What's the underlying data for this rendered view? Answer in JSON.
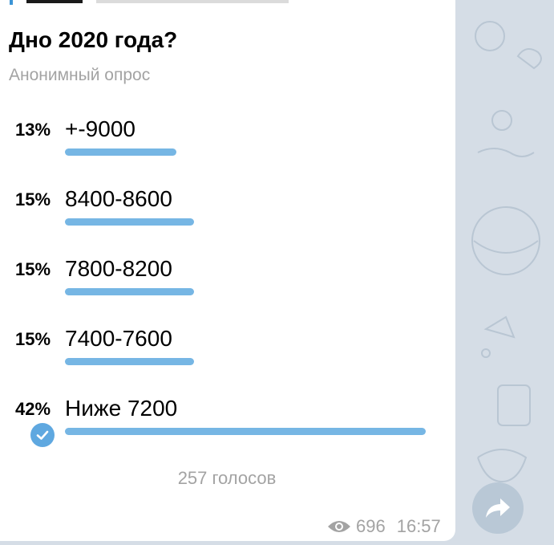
{
  "poll": {
    "title": "Дно 2020 года?",
    "type": "Анонимный опрос",
    "options": [
      {
        "percent": "13%",
        "label": "+-9000",
        "fraction": 0.13,
        "chosen": false
      },
      {
        "percent": "15%",
        "label": "8400-8600",
        "fraction": 0.15,
        "chosen": false
      },
      {
        "percent": "15%",
        "label": "7800-8200",
        "fraction": 0.15,
        "chosen": false
      },
      {
        "percent": "15%",
        "label": "7400-7600",
        "fraction": 0.15,
        "chosen": false
      },
      {
        "percent": "42%",
        "label": "Ниже 7200",
        "fraction": 0.42,
        "chosen": true
      }
    ],
    "total_votes": "257 голосов"
  },
  "message": {
    "views": "696",
    "time": "16:57"
  },
  "icons": {
    "eye": "eye-icon",
    "check": "check-icon",
    "share": "share-arrow-icon"
  },
  "colors": {
    "bar": "#76b6e4",
    "check": "#5fa8e0",
    "muted_text": "#a3a3a3",
    "background": "#d5dde6"
  }
}
